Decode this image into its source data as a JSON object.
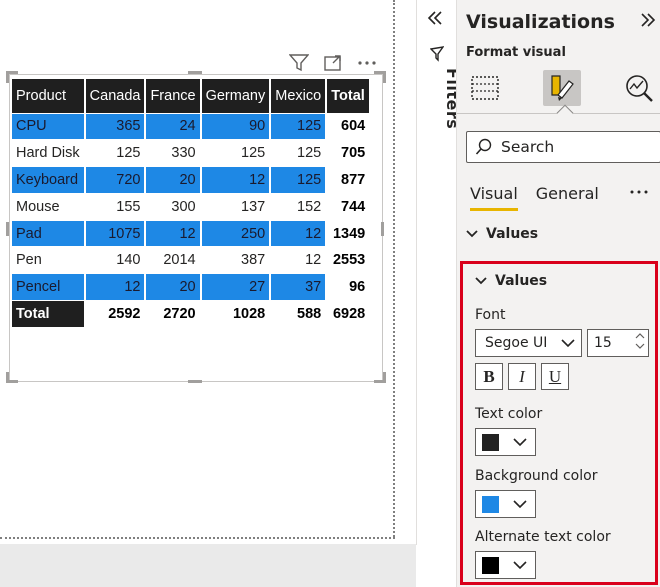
{
  "table": {
    "headers": [
      "Product",
      "Canada",
      "France",
      "Germany",
      "Mexico",
      "Total"
    ],
    "rows": [
      {
        "product": "CPU",
        "values": [
          "365",
          "24",
          "90",
          "125"
        ],
        "total": "604",
        "style": "blue"
      },
      {
        "product": "Hard Disk",
        "values": [
          "125",
          "330",
          "125",
          "125"
        ],
        "total": "705",
        "style": "white"
      },
      {
        "product": "Keyboard",
        "values": [
          "720",
          "20",
          "12",
          "125"
        ],
        "total": "877",
        "style": "blue"
      },
      {
        "product": "Mouse",
        "values": [
          "155",
          "300",
          "137",
          "152"
        ],
        "total": "744",
        "style": "white"
      },
      {
        "product": "Pad",
        "values": [
          "1075",
          "12",
          "250",
          "12"
        ],
        "total": "1349",
        "style": "blue"
      },
      {
        "product": "Pen",
        "values": [
          "140",
          "2014",
          "387",
          "12"
        ],
        "total": "2553",
        "style": "white"
      },
      {
        "product": "Pencel",
        "values": [
          "12",
          "20",
          "27",
          "37"
        ],
        "total": "96",
        "style": "blue"
      }
    ],
    "total_row": {
      "label": "Total",
      "values": [
        "2592",
        "2720",
        "1028",
        "588"
      ],
      "total": "6928"
    }
  },
  "colors": {
    "row_alt_bg": "#1e88e5",
    "header_bg": "#1f1f1f",
    "highlight_border": "#d9001b",
    "tab_underline": "#e8b500"
  },
  "filters": {
    "label": "Filters"
  },
  "pane": {
    "title": "Visualizations",
    "subtitle": "Format visual",
    "search_placeholder": "Search",
    "tabs": [
      "Visual",
      "General"
    ],
    "section": "Values",
    "subsection": "Values",
    "font_label": "Font",
    "font_family": "Segoe UI",
    "font_size": "15",
    "bold": "B",
    "italic": "I",
    "underline": "U",
    "text_color_label": "Text color",
    "text_color": "#222222",
    "bg_color_label": "Background color",
    "bg_color": "#1e88e5",
    "alt_text_color_label": "Alternate text color",
    "alt_text_color": "#000000"
  }
}
